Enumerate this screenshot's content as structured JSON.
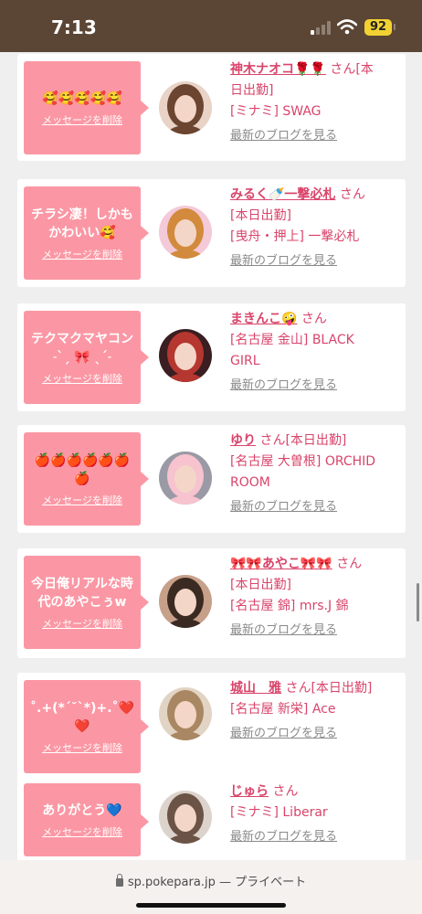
{
  "status_bar": {
    "time": "7:13",
    "battery": "92"
  },
  "browser": {
    "domain": "sp.pokepara.jp",
    "separator": "—",
    "mode": "プライベート"
  },
  "messages": [
    {
      "message": "🥰🥰🥰🥰🥰",
      "delete_label": "メッセージを削除",
      "cast_name": "神木ナオコ🌹🌹",
      "honorific": "さん",
      "line1_suffix": "[本",
      "lines": [
        "日出勤]",
        "[ミナミ] SWAG"
      ],
      "blog_link": "最新のブログを見る",
      "avatar_colors": [
        "#e9d2c6",
        "#6b4530"
      ]
    },
    {
      "message": "チラシ凄！しかもかわいい🥰",
      "delete_label": "メッセージを削除",
      "cast_name": "みるく🍼一撃必札",
      "honorific": "さん",
      "line1_suffix": "",
      "lines": [
        "[本日出勤]",
        "[曳舟・押上] 一撃必札"
      ],
      "blog_link": "最新のブログを見る",
      "avatar_colors": [
        "#f4c9d8",
        "#d28a3c"
      ]
    },
    {
      "message": "テクマクマヤコン˗ˋˏ 🎀 ˎˊ˗",
      "delete_label": "メッセージを削除",
      "cast_name": "まきんこ🤪",
      "honorific": "さん",
      "line1_suffix": "",
      "lines": [
        "[名古屋 金山] BLACK",
        "GIRL"
      ],
      "blog_link": "最新のブログを見る",
      "avatar_colors": [
        "#3a1e22",
        "#b5372f"
      ]
    },
    {
      "message": "🍎🍎🍎🍎🍎🍎🍎",
      "delete_label": "メッセージを削除",
      "cast_name": "ゆり",
      "honorific": "さん",
      "line1_suffix": "[本日出勤]",
      "lines": [
        "[名古屋 大曽根] ORCHID",
        "ROOM"
      ],
      "blog_link": "最新のブログを見る",
      "avatar_colors": [
        "#9a9aa6",
        "#f6c3cf"
      ]
    },
    {
      "message": "今日俺リアルな時代のあやこぅw",
      "delete_label": "メッセージを削除",
      "cast_name": "🎀🎀あやこ🎀🎀",
      "honorific": "さん",
      "line1_suffix": "",
      "lines": [
        "[本日出勤]",
        "[名古屋 錦] mrs.J 錦"
      ],
      "blog_link": "最新のブログを見る",
      "avatar_colors": [
        "#c7a08a",
        "#3b2a22"
      ]
    },
    {
      "message": "˚.+(*´˘`*)+.˚❤️❤️",
      "delete_label": "メッセージを削除",
      "cast_name": "城山　雅",
      "honorific": "さん",
      "line1_suffix": "[本日出勤]",
      "lines": [
        "[名古屋 新栄] Ace"
      ],
      "blog_link": "最新のブログを見る",
      "avatar_colors": [
        "#e2d4c4",
        "#a98762"
      ]
    },
    {
      "message": "ありがとう💙",
      "delete_label": "メッセージを削除",
      "cast_name": "じゅら",
      "honorific": "さん",
      "line1_suffix": "",
      "lines": [
        "[ミナミ] Liberar"
      ],
      "blog_link": "最新のブログを見る",
      "avatar_colors": [
        "#dcd4cc",
        "#6b5446"
      ]
    }
  ],
  "accent_color": "#d9446a",
  "bubble_color": "#fb97a4"
}
